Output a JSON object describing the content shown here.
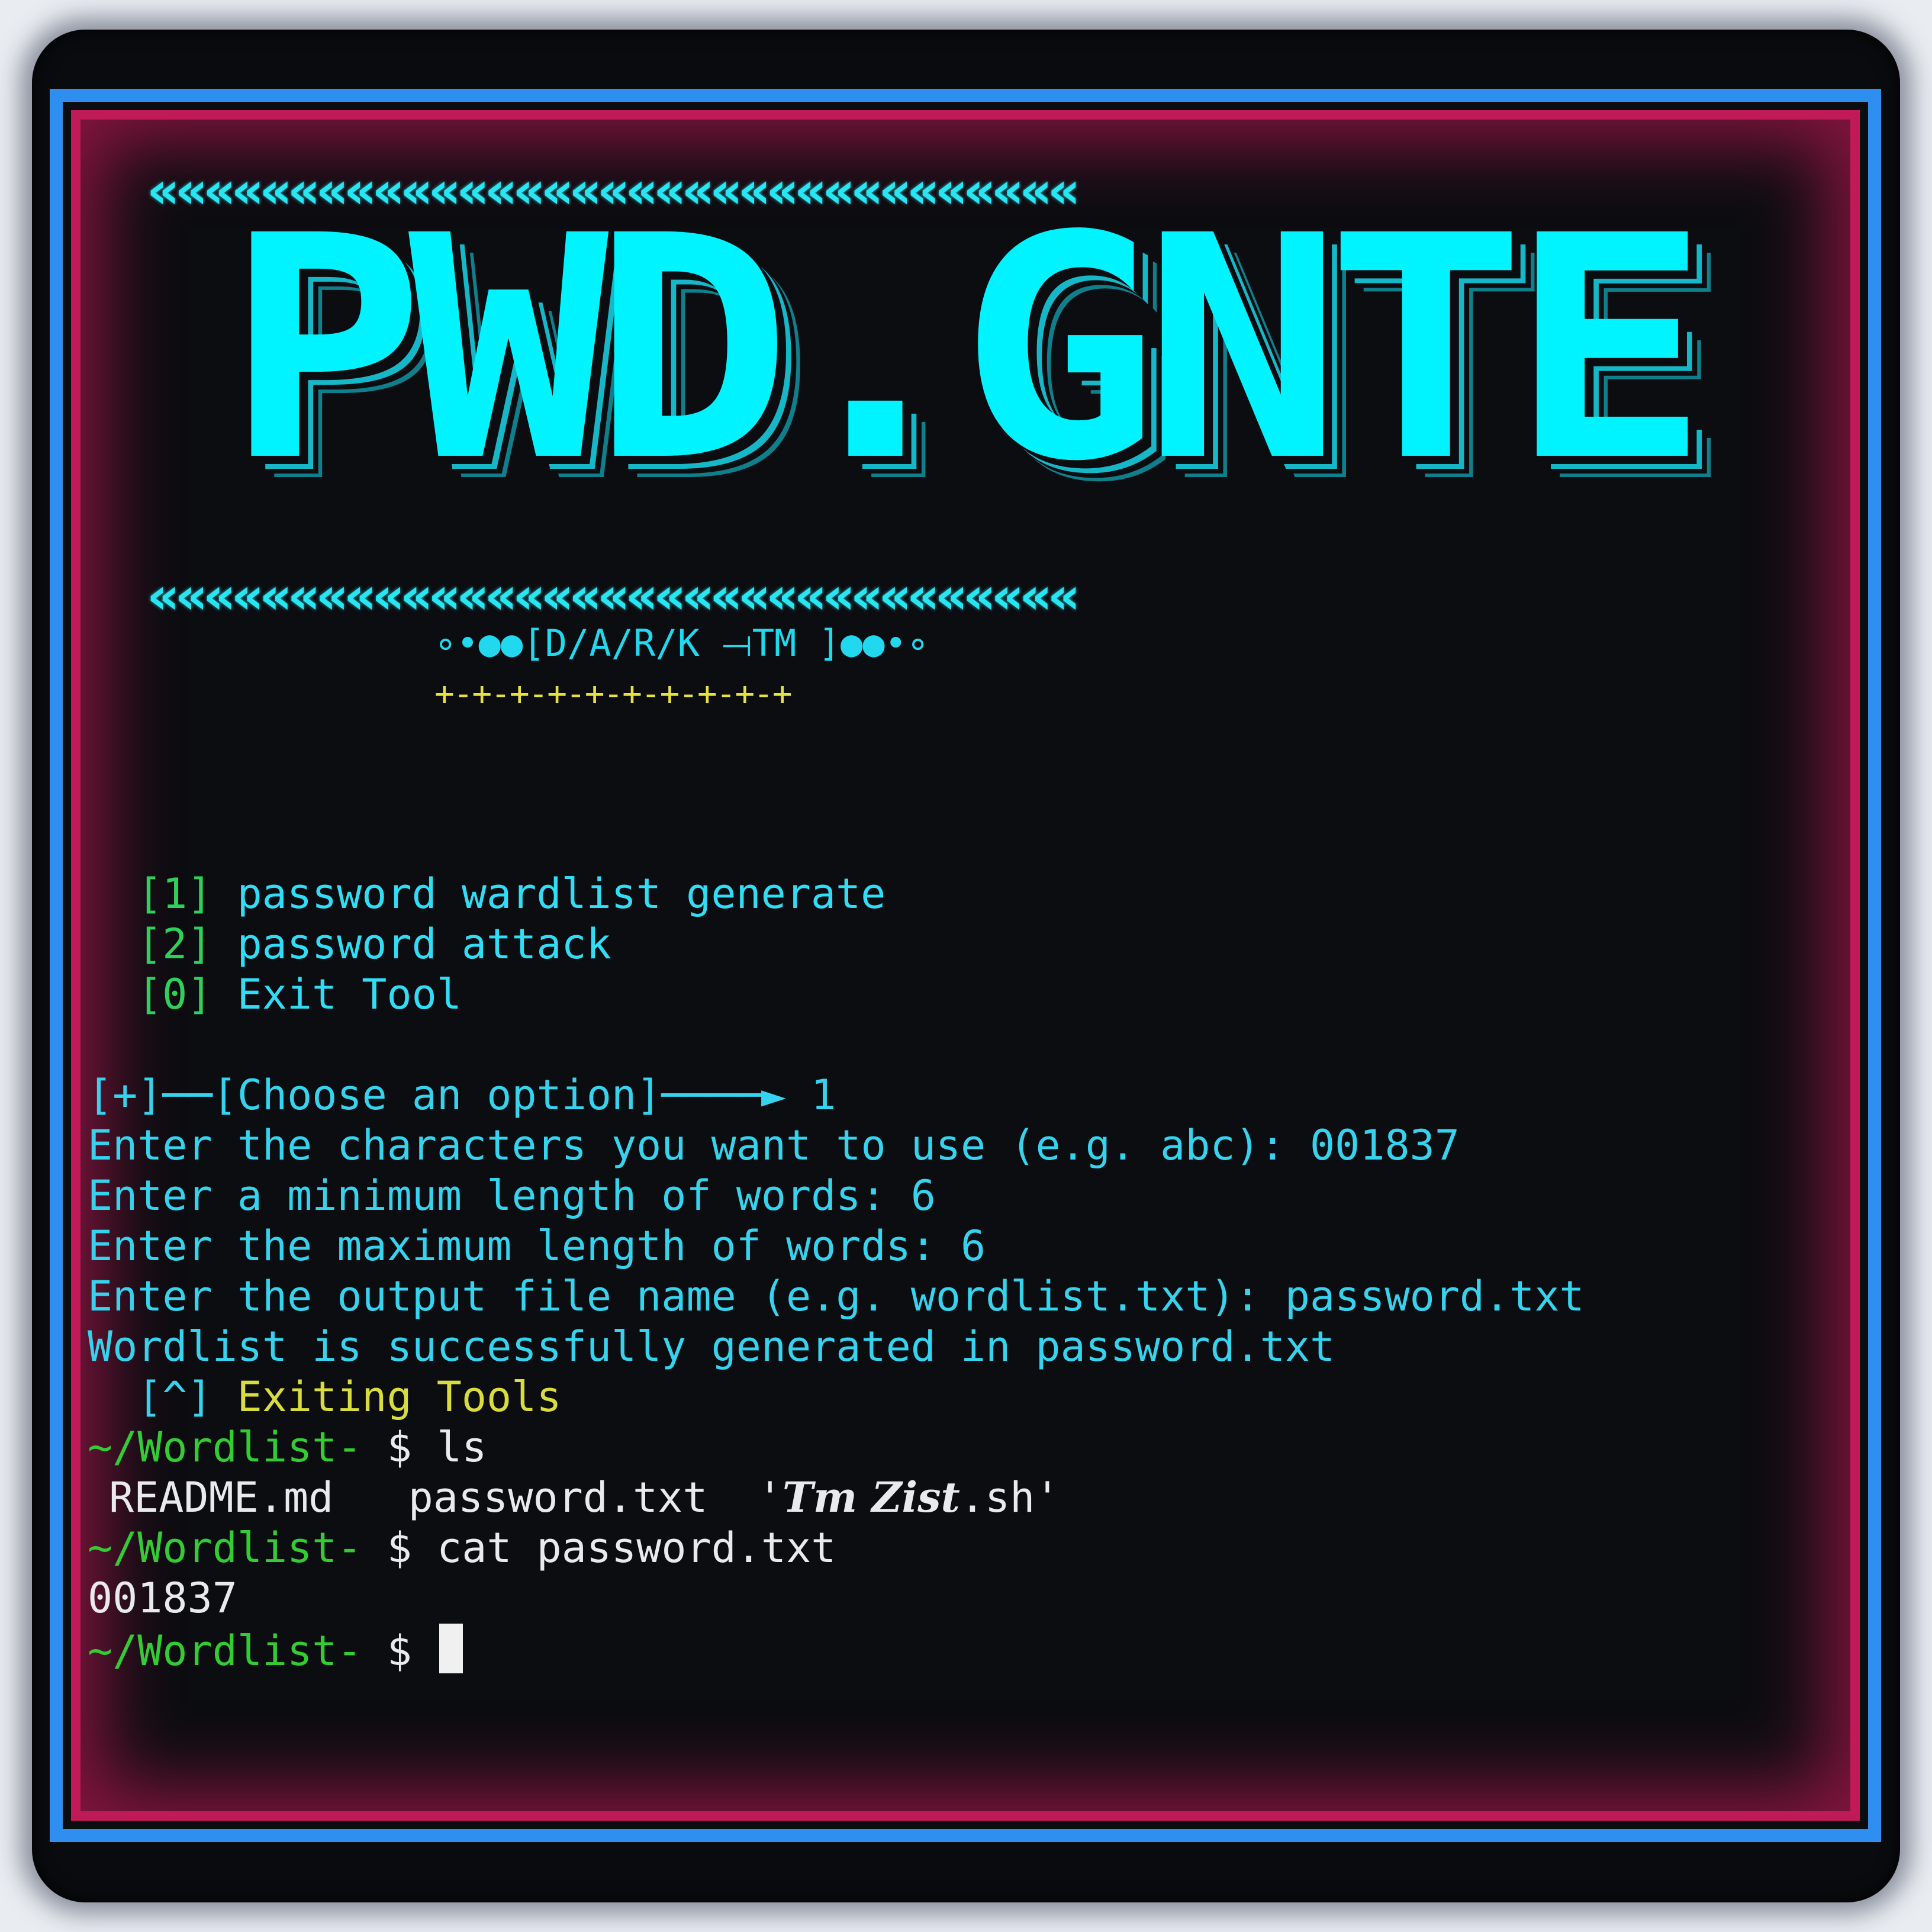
{
  "arrows": {
    "top": "«««««««««««««««««««««««««««««««««",
    "bottom": "«««««««««««««««««««««««««««««««««"
  },
  "logo": {
    "text": "PWD.GNTE"
  },
  "banner": {
    "dark": "∘•●●[D/A/R/K ⟞TM ]●●•∘",
    "plus": "+-+-+-+-+-+-+-+-+-+"
  },
  "menu": {
    "items": [
      {
        "key": "[1]",
        "label": "password wardlist generate"
      },
      {
        "key": "[2]",
        "label": "password attack"
      },
      {
        "key": "[0]",
        "label": "Exit Tool"
      }
    ]
  },
  "session": {
    "prompt_choose": "[+]──[Choose an option]────► 1",
    "chars": "Enter the characters you want to use (e.g. abc): 001837",
    "minlen": "Enter a minimum length of words: 6",
    "maxlen": "Enter the maximum length of words: 6",
    "outfile": "Enter the output file name (e.g. wordlist.txt): password.txt",
    "success": "Wordlist is successfully generated in password.txt",
    "exiting_key": "[^]",
    "exiting_text": "Exiting Tools"
  },
  "shell": {
    "cwd": "~/Wordlist-",
    "dollar": "$",
    "cmd_ls": "ls",
    "ls_readme": "README.md",
    "ls_password": "password.txt",
    "ls_script_open": "'",
    "ls_script_name": "Tm Zist",
    "ls_script_ext": ".sh'",
    "cmd_cat": "cat password.txt",
    "cat_output": "001837"
  }
}
